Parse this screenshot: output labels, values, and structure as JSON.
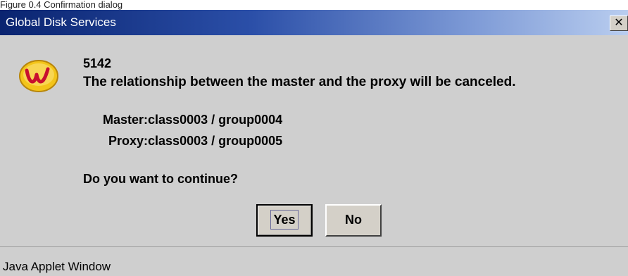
{
  "page_caption": "Figure 0.4 Confirmation dialog",
  "window": {
    "title": "Global Disk Services",
    "close_glyph": "✕",
    "icon": "w-app-icon"
  },
  "message": {
    "code": "5142",
    "text": "The relationship between the master and the proxy will be canceled.",
    "master_line": "Master:class0003 / group0004",
    "proxy_line": "Proxy:class0003 / group0005",
    "question": "Do you want to continue?"
  },
  "buttons": {
    "yes_label": "Yes",
    "no_label": "No"
  },
  "status_bar": {
    "text": "Java Applet Window"
  },
  "colors": {
    "title_start": "#0a2470",
    "title_end": "#b9cdef",
    "dialog_bg": "#cfcfcf",
    "icon_red": "#c8102e",
    "icon_gold": "#f3c41a"
  }
}
